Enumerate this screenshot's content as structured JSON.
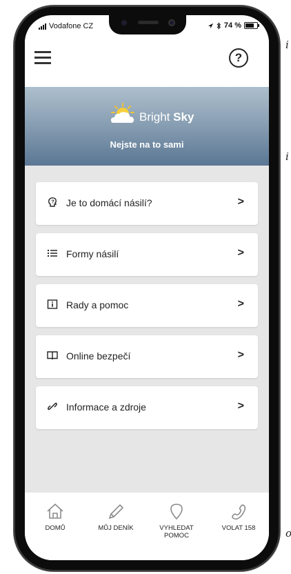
{
  "side_fragments": [
    "i",
    "i",
    "o"
  ],
  "status_bar": {
    "carrier": "Vodafone CZ",
    "battery": "74 %"
  },
  "hero": {
    "brand_light": "Bright",
    "brand_bold": "Sky",
    "tagline": "Nejste na to sami"
  },
  "menu": {
    "items": [
      {
        "label": "Je to domácí násilí?",
        "icon": "question-head-icon"
      },
      {
        "label": "Formy násilí",
        "icon": "list-icon"
      },
      {
        "label": "Rady a pomoc",
        "icon": "info-icon"
      },
      {
        "label": "Online bezpečí",
        "icon": "book-icon"
      },
      {
        "label": "Informace a zdroje",
        "icon": "link-icon"
      }
    ],
    "chevron": ">"
  },
  "bottom_nav": [
    {
      "label": "DOMŮ",
      "icon": "home-icon"
    },
    {
      "label": "MŮJ DENÍK",
      "icon": "pencil-icon"
    },
    {
      "label": "VYHLEDAT\nPOMOC",
      "icon": "location-pin-icon"
    },
    {
      "label": "VOLAT 158",
      "icon": "phone-icon"
    }
  ]
}
